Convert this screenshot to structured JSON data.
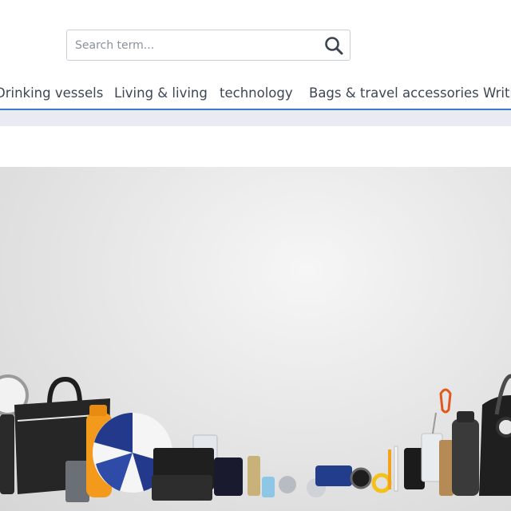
{
  "search": {
    "placeholder": "Search term..."
  },
  "nav": {
    "items": [
      {
        "label": "Drinking vessels"
      },
      {
        "label": "Living & living"
      },
      {
        "label": "technology"
      },
      {
        "label": "Bags & travel accessories"
      },
      {
        "label": "Writing"
      }
    ]
  },
  "colors": {
    "accent": "#3f78c9",
    "subbar": "#e8ebf2",
    "text": "#3d4753"
  },
  "icons": {
    "search": "search-icon"
  }
}
